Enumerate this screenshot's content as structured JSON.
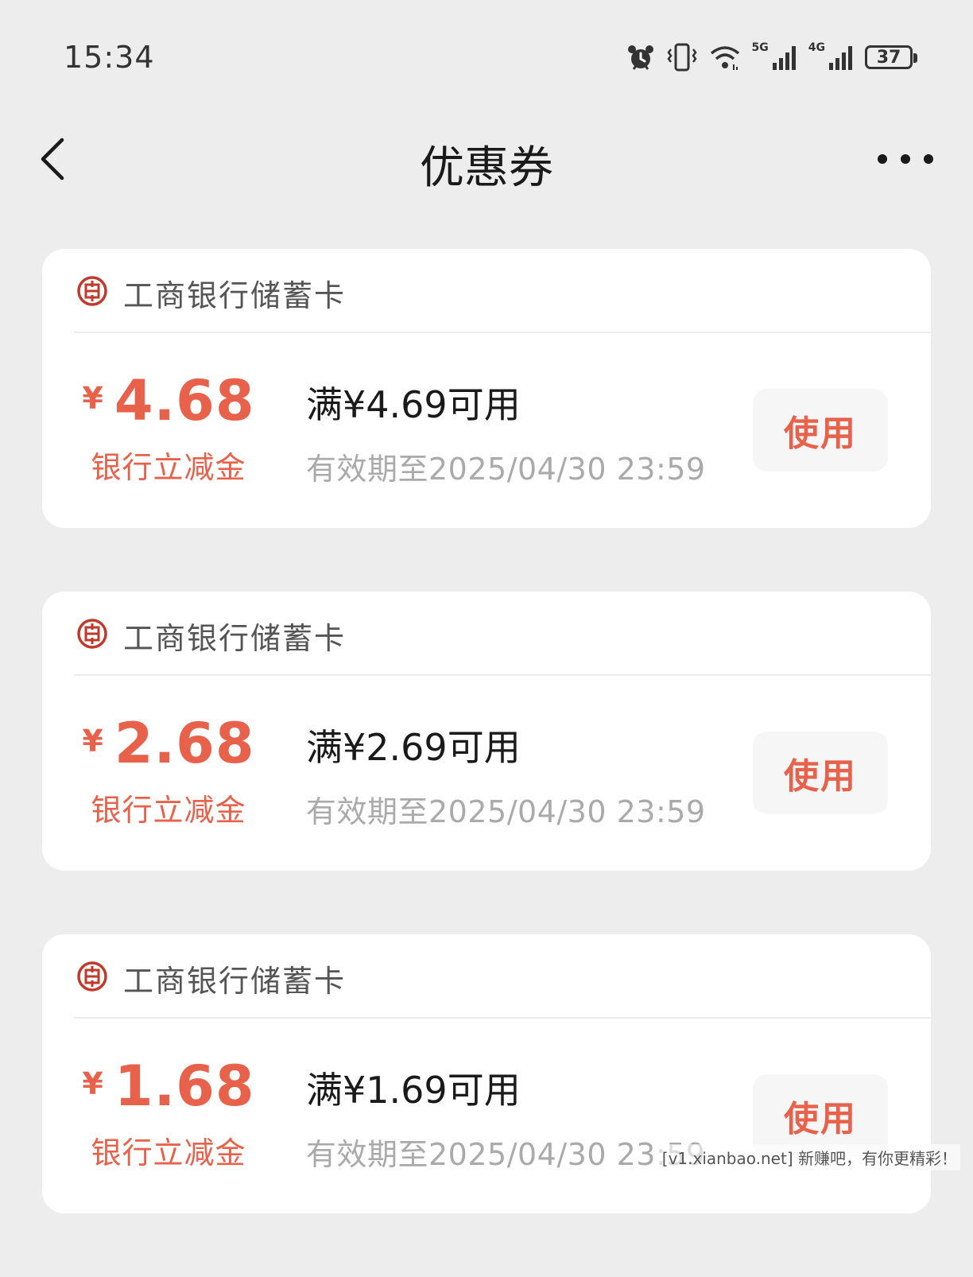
{
  "status_bar": {
    "time": "15:34",
    "net1_label": "5G",
    "net2_label": "4G",
    "battery": "37",
    "icons": [
      "alarm-icon",
      "vibrate-icon",
      "wifi-icon",
      "signal-5g-icon",
      "signal-4g-icon",
      "battery-icon"
    ]
  },
  "nav": {
    "title": "优惠券",
    "back_icon": "chevron-left-icon",
    "more_icon": "more-dots-icon"
  },
  "coupons": [
    {
      "bank": "工商银行储蓄卡",
      "currency": "¥",
      "amount": "4.68",
      "type": "银行立减金",
      "condition": "满¥4.69可用",
      "validity": "有效期至2025/04/30 23:59",
      "button": "使用"
    },
    {
      "bank": "工商银行储蓄卡",
      "currency": "¥",
      "amount": "2.68",
      "type": "银行立减金",
      "condition": "满¥2.69可用",
      "validity": "有效期至2025/04/30 23:59",
      "button": "使用"
    },
    {
      "bank": "工商银行储蓄卡",
      "currency": "¥",
      "amount": "1.68",
      "type": "银行立减金",
      "condition": "满¥1.69可用",
      "validity": "有效期至2025/04/30 23:59",
      "button": "使用"
    }
  ],
  "colors": {
    "accent": "#e8614a",
    "logo": "#c0392b",
    "background": "#ededed"
  },
  "watermark": "[v1.xianbao.net] 新赚吧，有你更精彩！"
}
